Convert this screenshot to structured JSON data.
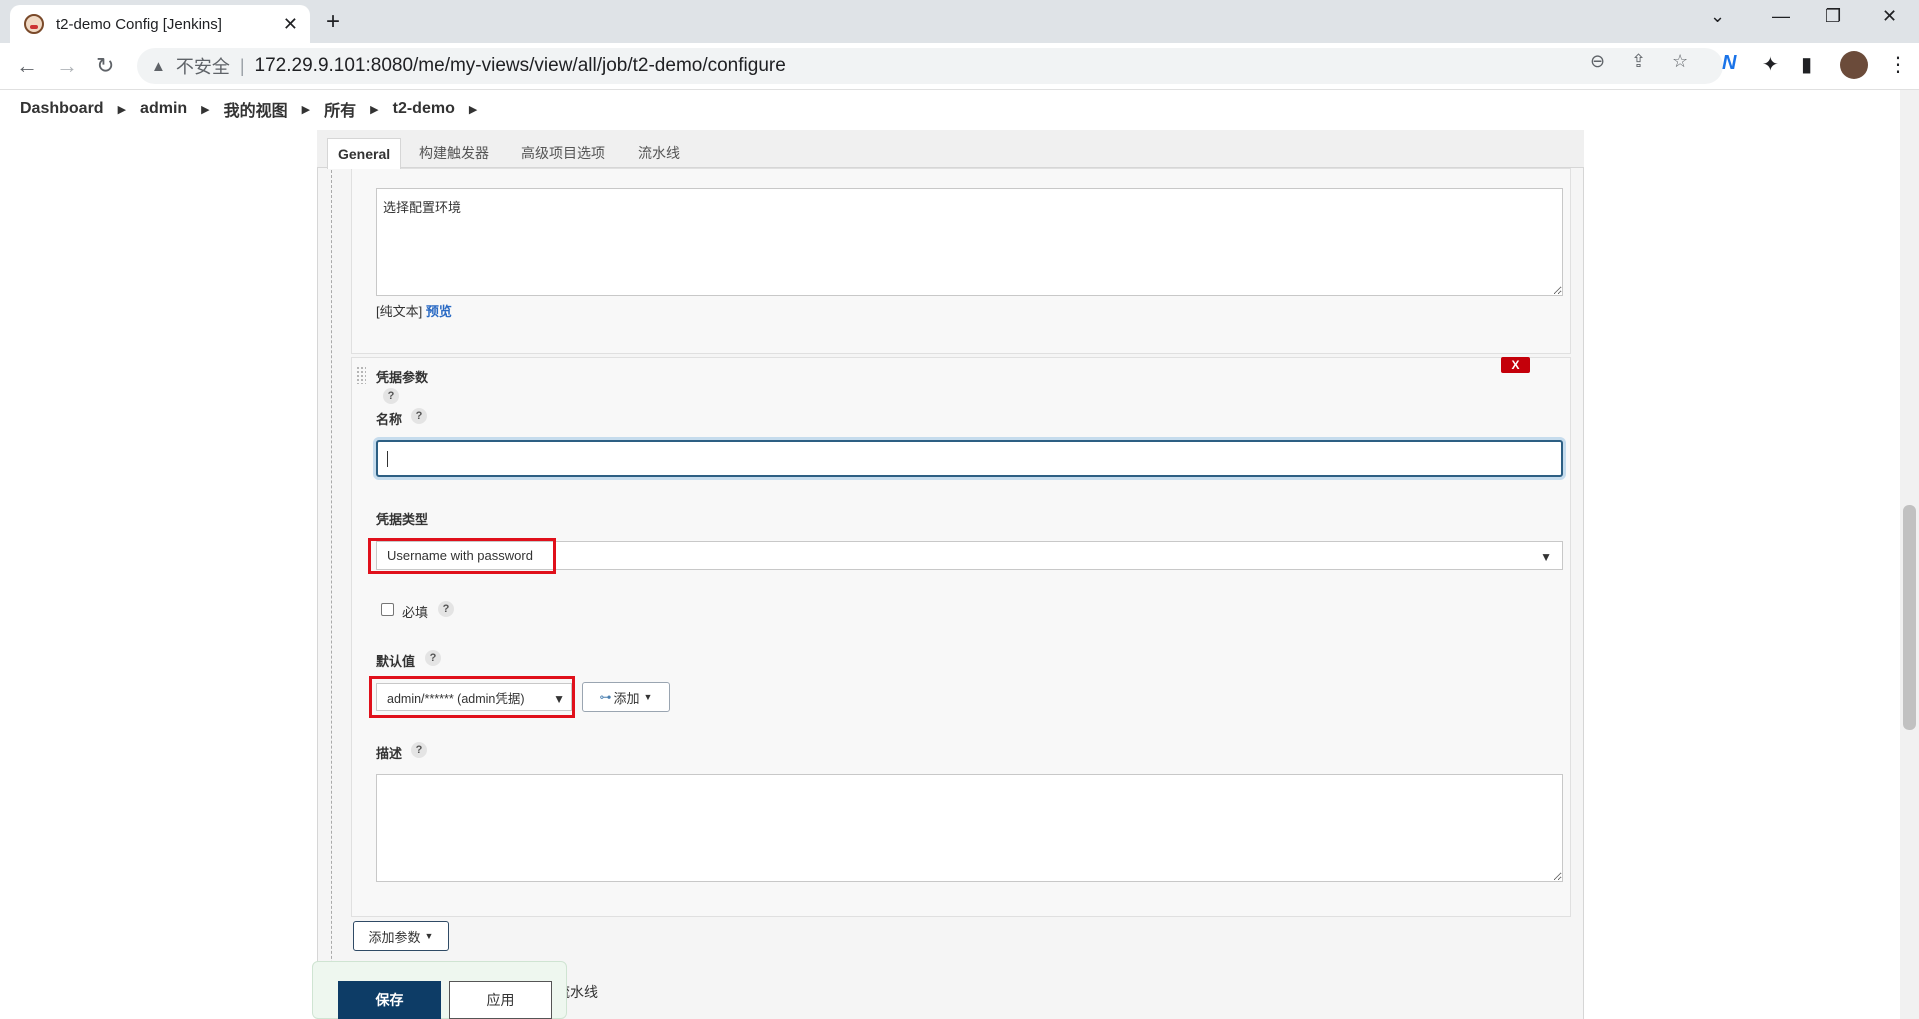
{
  "browser": {
    "tab_title": "t2-demo Config [Jenkins]",
    "security_label": "不安全",
    "url": "172.29.9.101:8080/me/my-views/view/all/job/t2-demo/configure"
  },
  "breadcrumb": {
    "items": [
      "Dashboard",
      "admin",
      "我的视图",
      "所有",
      "t2-demo"
    ]
  },
  "config_tabs": [
    "General",
    "构建触发器",
    "高级项目选项",
    "流水线"
  ],
  "prev_param": {
    "description_value": "选择配置环境",
    "plain_text": "[纯文本]",
    "preview": "预览"
  },
  "credential_param": {
    "title": "凭据参数",
    "delete_label": "X",
    "name_label": "名称",
    "name_value": "",
    "type_label": "凭据类型",
    "type_value": "Username with password",
    "required_label": "必填",
    "required_checked": false,
    "default_label": "默认值",
    "default_value": "admin/****** (admin凭据)",
    "add_label": "添加",
    "description_label": "描述",
    "description_value": ""
  },
  "help_symbol": "?",
  "add_param_label": "添加参数",
  "footer": {
    "save_label": "保存",
    "apply_label": "应用",
    "behind_text": "流水线"
  }
}
